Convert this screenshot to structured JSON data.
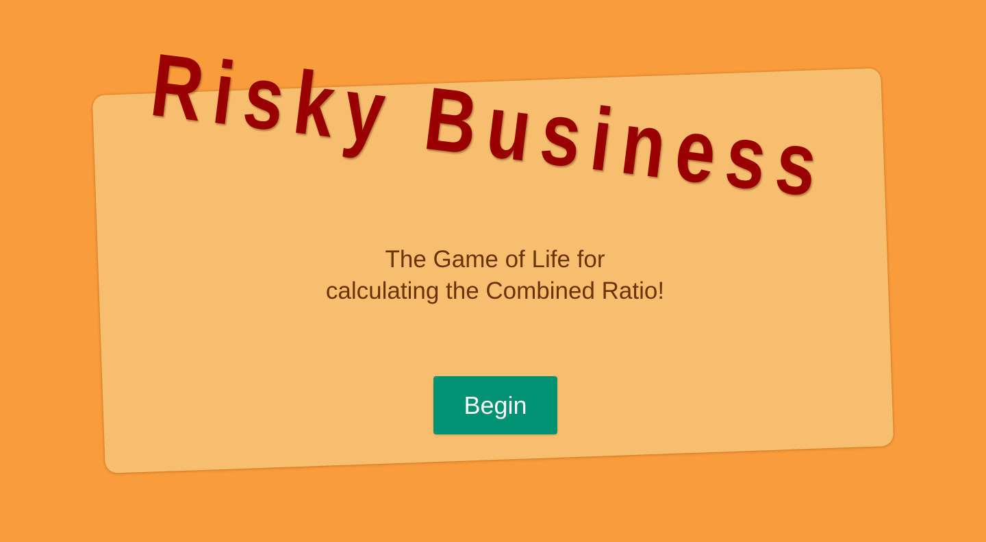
{
  "game": {
    "title": "Risky Business",
    "subtitle_line1": "The Game of Life for",
    "subtitle_line2": "calculating the Combined Ratio!",
    "begin_label": "Begin"
  },
  "colors": {
    "background": "#f99c3c",
    "card": "#f6be6e",
    "title": "#990000",
    "subtitle": "#6b3300",
    "button": "#009272",
    "button_text": "#ffffff"
  }
}
